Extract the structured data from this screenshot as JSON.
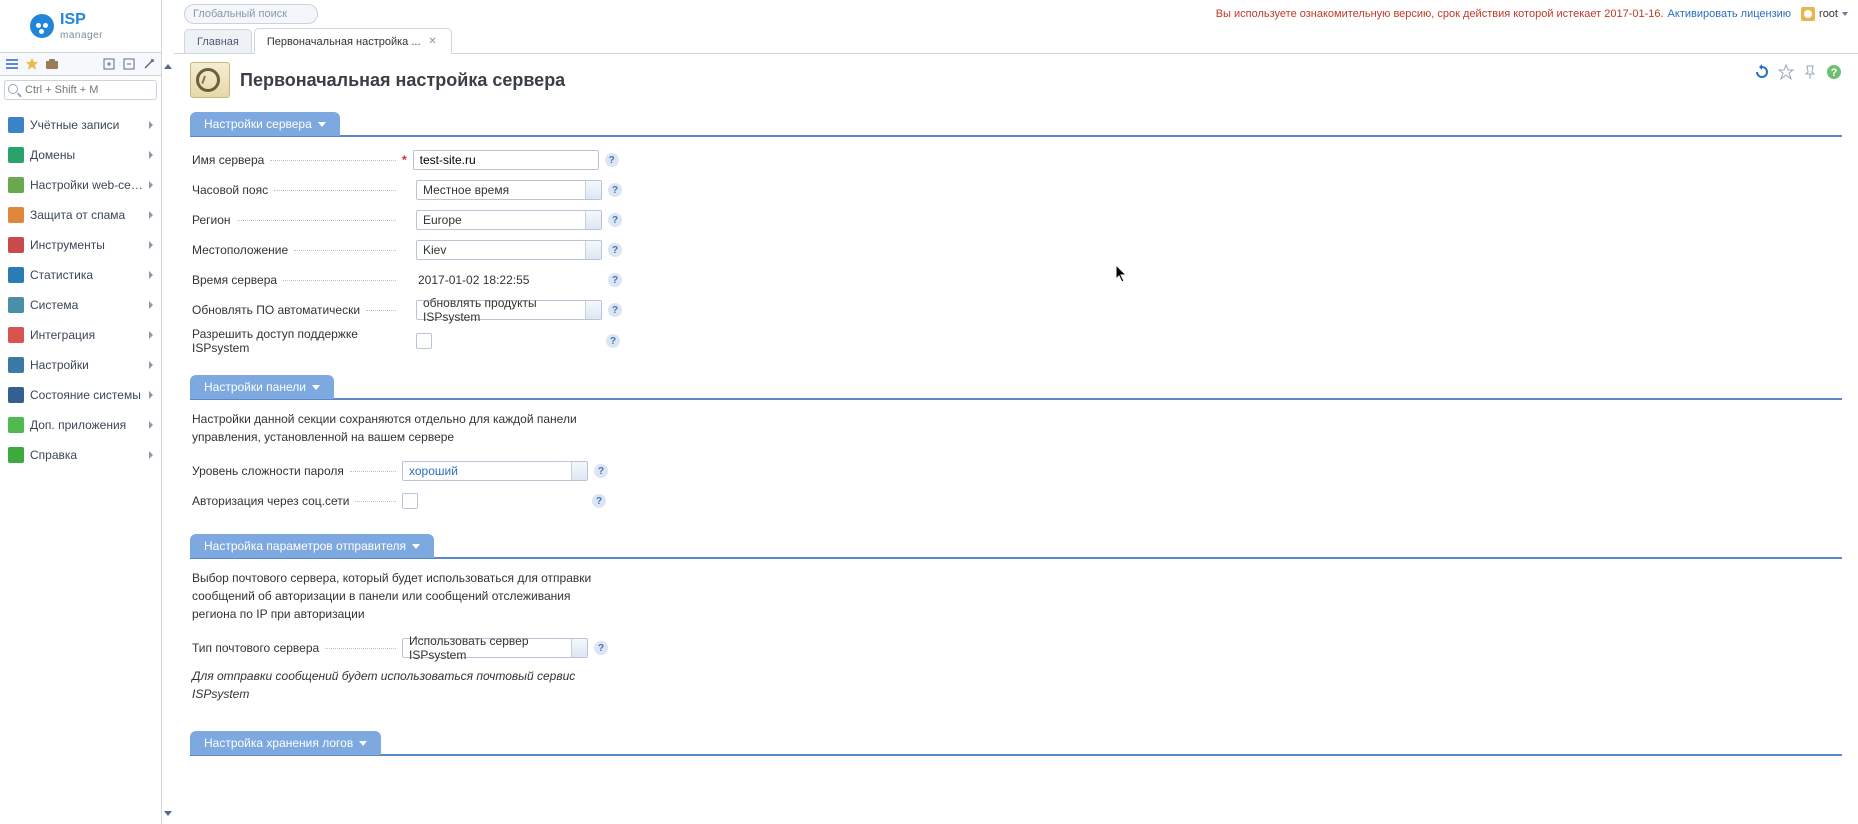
{
  "header": {
    "global_search_placeholder": "Глобальный поиск",
    "trial_text": "Вы используете ознакомительную версию, срок действия которой истекает 2017-01-16.",
    "activate_link": "Активировать лицензию",
    "user": "root"
  },
  "sidebar": {
    "quick_search_placeholder": "Ctrl + Shift + M",
    "items": [
      {
        "label": "Учётные записи",
        "color": "#3b82c9"
      },
      {
        "label": "Домены",
        "color": "#2aa36b"
      },
      {
        "label": "Настройки web-сер…",
        "color": "#6aa84f"
      },
      {
        "label": "Защита от спама",
        "color": "#e0863a"
      },
      {
        "label": "Инструменты",
        "color": "#c94a4a"
      },
      {
        "label": "Статистика",
        "color": "#2a7db3"
      },
      {
        "label": "Система",
        "color": "#4a8fa8"
      },
      {
        "label": "Интеграция",
        "color": "#d9534f"
      },
      {
        "label": "Настройки",
        "color": "#3a7ba6"
      },
      {
        "label": "Состояние системы",
        "color": "#365f91"
      },
      {
        "label": "Доп. приложения",
        "color": "#4fb84f"
      },
      {
        "label": "Справка",
        "color": "#3caa3c"
      }
    ]
  },
  "tabs": [
    {
      "label": "Главная",
      "active": false,
      "closable": false
    },
    {
      "label": "Первоначальная настройка ...",
      "active": true,
      "closable": true
    }
  ],
  "page": {
    "title": "Первоначальная настройка сервера"
  },
  "sections": {
    "server": {
      "title": "Настройки сервера",
      "fields": {
        "name_label": "Имя сервера",
        "name_value": "test-site.ru",
        "tz_label": "Часовой пояс",
        "tz_value": "Местное время",
        "region_label": "Регион",
        "region_value": "Europe",
        "location_label": "Местоположение",
        "location_value": "Kiev",
        "time_label": "Время сервера",
        "time_value": "2017-01-02 18:22:55",
        "autoupdate_label": "Обновлять ПО автоматически",
        "autoupdate_value": "обновлять продукты ISPsystem",
        "support_label": "Разрешить доступ поддержке ISPsystem"
      }
    },
    "panel": {
      "title": "Настройки панели",
      "note": "Настройки данной секции сохраняются отдельно для каждой панели управления, установленной на вашем сервере",
      "pw_label": "Уровень сложности пароля",
      "pw_value": "хороший",
      "social_label": "Авторизация через соц.сети"
    },
    "sender": {
      "title": "Настройка параметров отправителя",
      "note": "Выбор почтового сервера, который будет использоваться для отправки сообщений об авторизации в панели или сообщений отслеживания региона по IP при авторизации",
      "type_label": "Тип почтового сервера",
      "type_value": "Использовать сервер ISPsystem",
      "hint": "Для отправки сообщений будет использоваться почтовый сервис ISPsystem"
    },
    "logs": {
      "title": "Настройка хранения логов"
    }
  }
}
